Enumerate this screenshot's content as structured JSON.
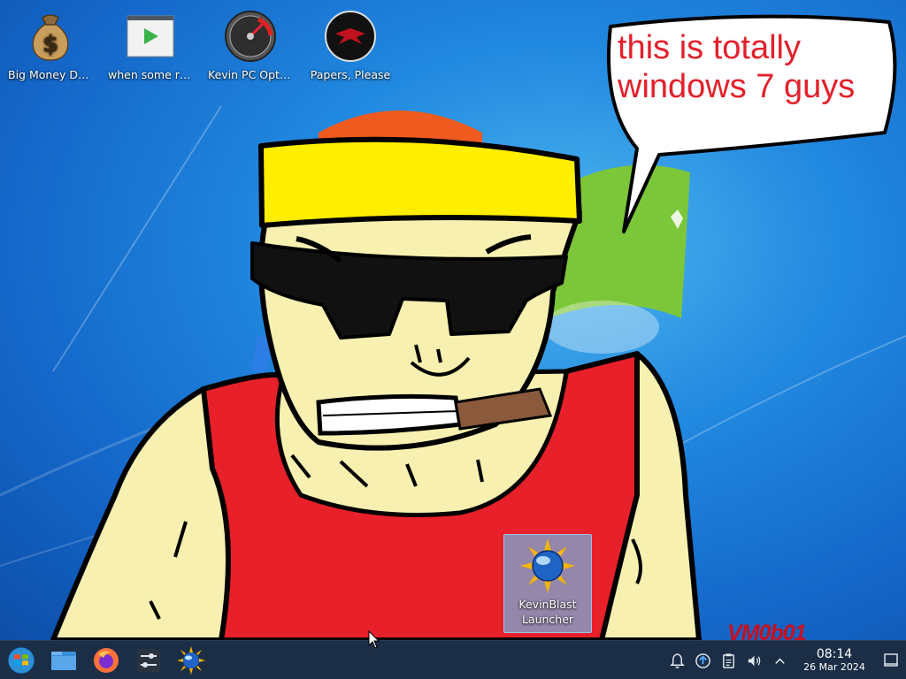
{
  "desktop": {
    "icons": [
      {
        "label": "Big Money Deluxe",
        "icon": "money-bag-icon"
      },
      {
        "label": "when some russian runs a...",
        "icon": "video-player-icon"
      },
      {
        "label": "Kevin PC Optimizer Ho...",
        "icon": "speedometer-icon"
      },
      {
        "label": "Papers, Please",
        "icon": "eagle-emblem-icon"
      },
      {
        "label": "KevinBlast Launcher",
        "icon": "sun-globe-icon",
        "selected": true
      }
    ],
    "speech_bubble": "this is totally\nwindows 7 guys",
    "watermark": "VM0b01"
  },
  "taskbar": {
    "pinned": [
      {
        "name": "start-menu",
        "icon": "windows-orb-icon"
      },
      {
        "name": "file-manager",
        "icon": "folder-icon"
      },
      {
        "name": "firefox",
        "icon": "firefox-icon"
      },
      {
        "name": "system-settings",
        "icon": "sliders-icon"
      },
      {
        "name": "kevinblast",
        "icon": "sun-globe-icon"
      }
    ],
    "tray": [
      {
        "name": "notifications",
        "icon": "bell-icon"
      },
      {
        "name": "updates",
        "icon": "update-arrow-icon"
      },
      {
        "name": "clipboard",
        "icon": "clipboard-icon"
      },
      {
        "name": "volume",
        "icon": "speaker-muted-icon"
      },
      {
        "name": "show-hidden",
        "icon": "chevron-up-icon"
      }
    ],
    "clock": {
      "time": "08:14",
      "date": "26 Mar 2024"
    }
  },
  "colors": {
    "wallpaper": "#1b6fd0",
    "taskbar": "#1c232e",
    "bubble_text": "#e3202b",
    "headband": "#ffee00",
    "shirt": "#e8202a",
    "skin": "#f8f0b0"
  }
}
